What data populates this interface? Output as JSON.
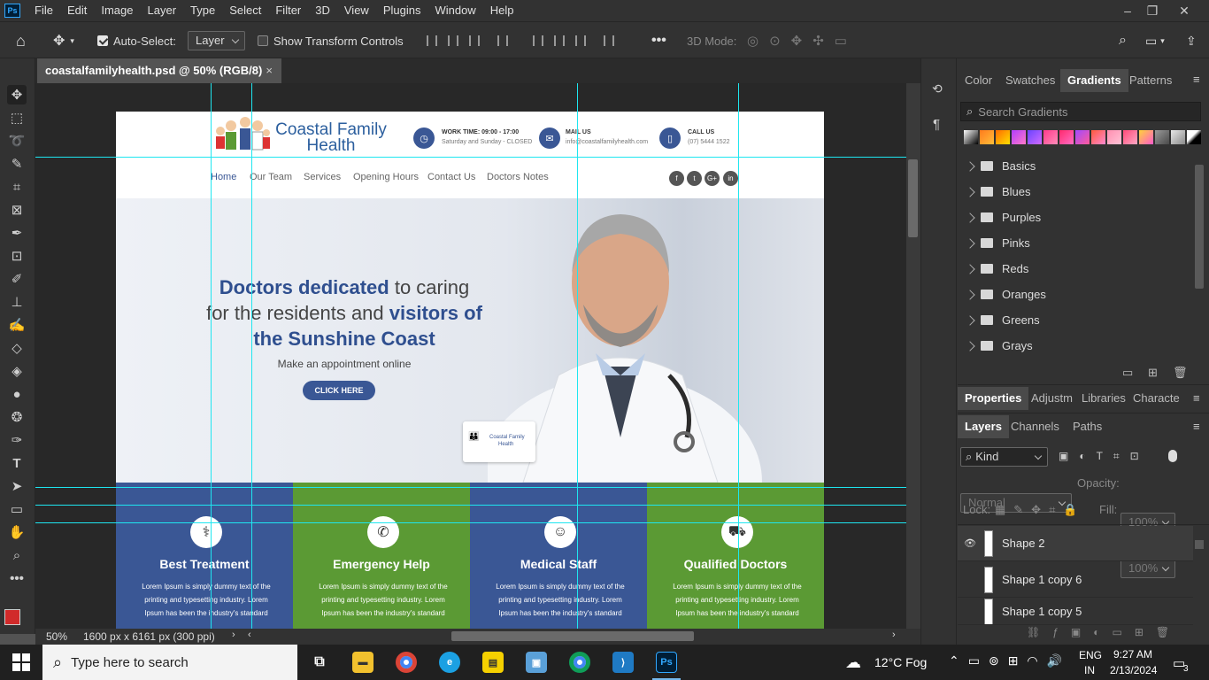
{
  "app": {
    "logo": "Ps",
    "menu": [
      "File",
      "Edit",
      "Image",
      "Layer",
      "Type",
      "Select",
      "Filter",
      "3D",
      "View",
      "Plugins",
      "Window",
      "Help"
    ],
    "window_controls": [
      "minimize",
      "restore",
      "close"
    ]
  },
  "options": {
    "auto_select_label": "Auto-Select:",
    "auto_select_checked": true,
    "auto_select_target": "Layer",
    "transform_label": "Show Transform Controls",
    "transform_checked": false,
    "mode_3d_label": "3D Mode:"
  },
  "tools": [
    "move-tool",
    "marquee-tool",
    "lasso-tool",
    "quick-select-tool",
    "crop-tool",
    "frame-tool",
    "eyedropper-tool",
    "healing-brush-tool",
    "brush-tool",
    "clone-stamp-tool",
    "history-brush-tool",
    "eraser-tool",
    "paint-bucket-tool",
    "blur-tool",
    "dodge-tool",
    "pen-tool",
    "type-tool",
    "path-select-tool",
    "rectangle-tool",
    "hand-tool",
    "zoom-tool",
    "more-tools"
  ],
  "colors": {
    "foreground": "#d12a2a",
    "background": "#ffffff",
    "guide": "#1ee6f0",
    "site_blue": "#3a5795",
    "site_green": "#5b9a34"
  },
  "document": {
    "tab_title": "coastalfamilyhealth.psd @ 50% (RGB/8)",
    "zoom": "50%",
    "doc_info": "1600 px x 6161 px (300 ppi)"
  },
  "site": {
    "logo_line1": "Coastal Family",
    "logo_line2": "Health",
    "info": [
      {
        "icon": "clock-icon",
        "title": "WORK TIME: 09:00 - 17:00",
        "sub": "Saturday and Sunday - CLOSED"
      },
      {
        "icon": "mail-icon",
        "title": "MAIL US",
        "sub": "info@coastalfamilyhealth.com"
      },
      {
        "icon": "phone-icon",
        "title": "CALL US",
        "sub": "(07) 5444 1522"
      }
    ],
    "nav": [
      "Home",
      "Our Team",
      "Services",
      "Opening Hours",
      "Contact Us",
      "Doctors Notes"
    ],
    "social": [
      "f",
      "t",
      "G+",
      "in"
    ],
    "hero": {
      "line1_bold": "Doctors dedicated",
      "line1_rest": " to caring",
      "line2_rest": "for the residents and ",
      "line2_bold": "visitors of",
      "line3_bold": "the Sunshine Coast",
      "sub": "Make an appointment online",
      "cta": "CLICK HERE",
      "card_line1": "Coastal Family",
      "card_line2": "Health"
    },
    "features": [
      {
        "title": "Best Treatment",
        "icon": "stethoscope-icon",
        "color": "#3a5795",
        "text": "Lorem Ipsum is simply dummy text of the printing and typesetting industry. Lorem Ipsum has been the industry's standard"
      },
      {
        "title": "Emergency Help",
        "icon": "phone-plus-icon",
        "color": "#5b9a34",
        "text": "Lorem Ipsum is simply dummy text of the printing and typesetting industry. Lorem Ipsum has been the industry's standard"
      },
      {
        "title": "Medical Staff",
        "icon": "nurse-icon",
        "color": "#3a5795",
        "text": "Lorem Ipsum is simply dummy text of the printing and typesetting industry. Lorem Ipsum has been the industry's standard"
      },
      {
        "title": "Qualified Doctors",
        "icon": "ambulance-icon",
        "color": "#5b9a34",
        "text": "Lorem Ipsum is simply dummy text of the printing and typesetting industry. Lorem Ipsum has been the industry's standard"
      }
    ]
  },
  "panels": {
    "top_tabs": [
      "Color",
      "Swatches",
      "Gradients",
      "Patterns"
    ],
    "active_top_tab": "Gradients",
    "search_placeholder": "Search Gradients",
    "gradient_folders": [
      "Basics",
      "Blues",
      "Purples",
      "Pinks",
      "Reds",
      "Oranges",
      "Greens",
      "Grays"
    ],
    "mid_tabs": [
      "Properties",
      "Adjustm",
      "Libraries",
      "Characte"
    ],
    "layer_tabs": [
      "Layers",
      "Channels",
      "Paths"
    ],
    "filter_kind": "Kind",
    "blend_mode": "Normal",
    "opacity_label": "Opacity:",
    "opacity_value": "100%",
    "lock_label": "Lock:",
    "fill_label": "Fill:",
    "fill_value": "100%",
    "layers": [
      {
        "name": "Shape 2",
        "visible": true
      },
      {
        "name": "Shape 1 copy 6",
        "visible": false
      },
      {
        "name": "Shape 1 copy 5",
        "visible": false
      }
    ]
  },
  "taskbar": {
    "search_placeholder": "Type here to search",
    "weather": "12°C  Fog",
    "lang1": "ENG",
    "lang2": "IN",
    "time": "9:27 AM",
    "date": "2/13/2024",
    "notif_count": "3"
  }
}
